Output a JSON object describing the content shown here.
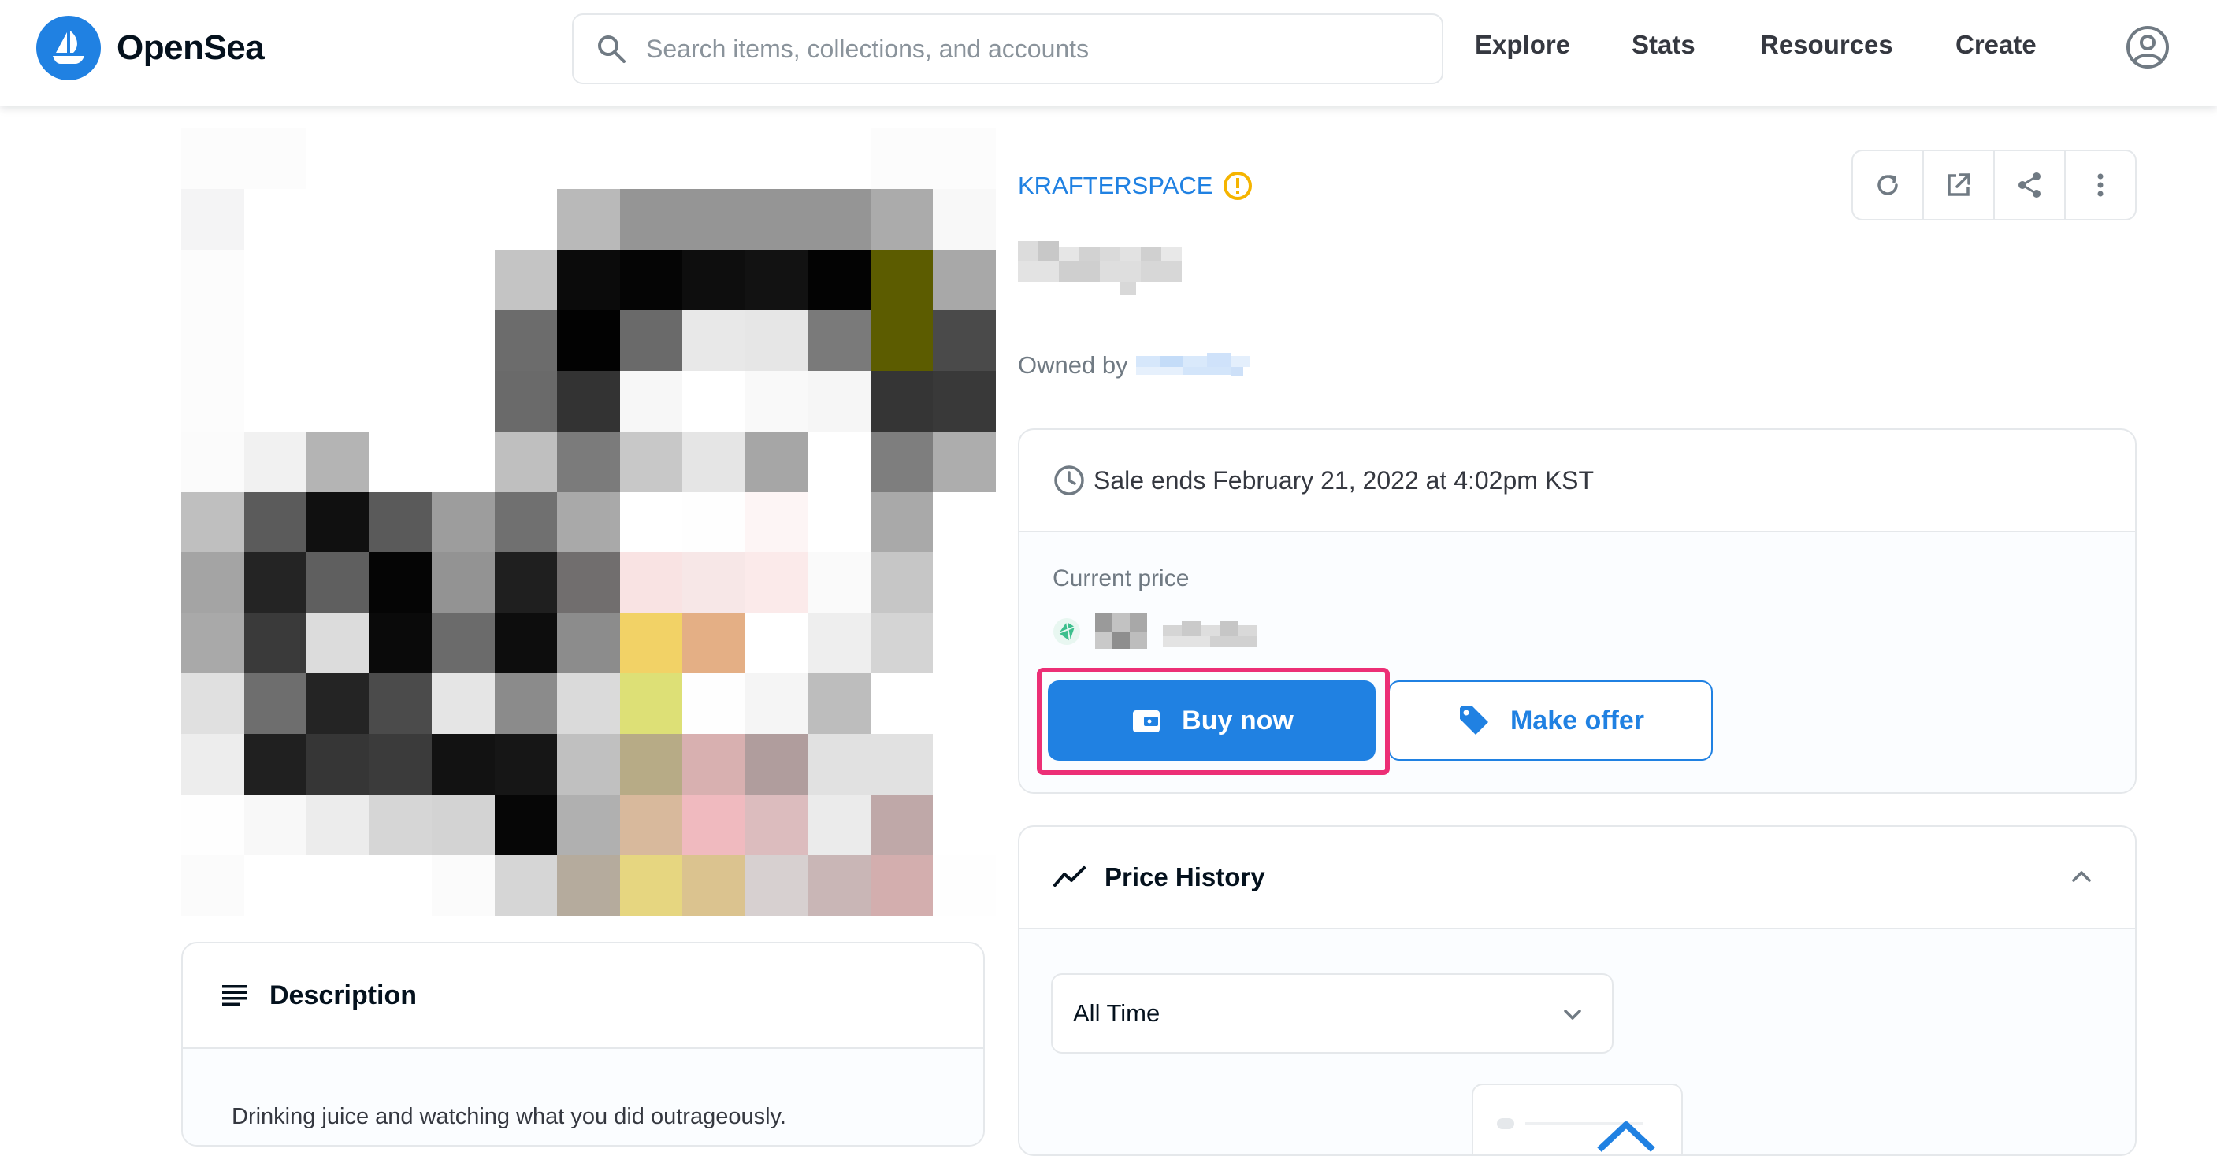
{
  "header": {
    "brand": "OpenSea",
    "search_placeholder": "Search items, collections, and accounts",
    "nav": [
      "Explore",
      "Stats",
      "Resources",
      "Create"
    ]
  },
  "item": {
    "collection": "KRAFTERSPACE",
    "owner_label": "Owned by"
  },
  "sale": {
    "ends_text": "Sale ends February 21, 2022 at 4:02pm KST",
    "current_price_label": "Current price",
    "buy_label": "Buy now",
    "offer_label": "Make offer"
  },
  "price_history": {
    "title": "Price History",
    "range": "All Time"
  },
  "description": {
    "title": "Description",
    "text": "Drinking juice and watching what you did outrageously."
  },
  "colors": {
    "accent": "#2081e2",
    "highlight": "#ec2f76",
    "warning": "#f5b400"
  }
}
